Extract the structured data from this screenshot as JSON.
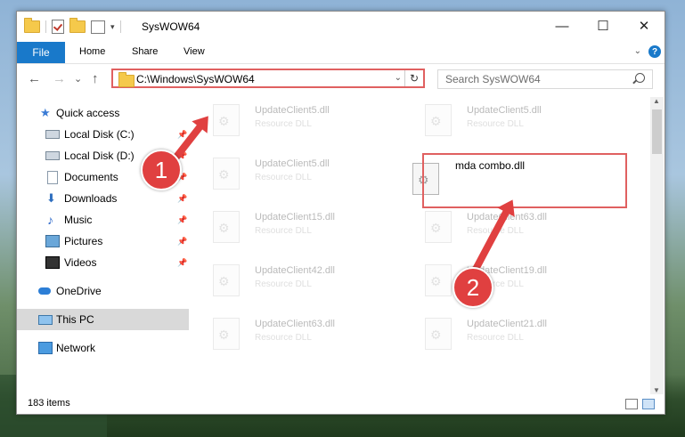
{
  "window": {
    "title": "SysWOW64",
    "minimize": "—",
    "maximize": "☐",
    "close": "✕"
  },
  "menu": {
    "file": "File",
    "home": "Home",
    "share": "Share",
    "view": "View",
    "help": "?"
  },
  "nav": {
    "back": "←",
    "forward": "→",
    "recent": "⌄",
    "up": "↑",
    "address": "C:\\Windows\\SysWOW64",
    "search_placeholder": "Search SysWOW64"
  },
  "sidebar": {
    "items": [
      {
        "label": "Quick access",
        "icon": "star-icon",
        "pinned": false
      },
      {
        "label": "Local Disk (C:)",
        "icon": "drive-icon",
        "pinned": true
      },
      {
        "label": "Local Disk (D:)",
        "icon": "drive-icon",
        "pinned": true
      },
      {
        "label": "Documents",
        "icon": "documents-icon",
        "pinned": true
      },
      {
        "label": "Downloads",
        "icon": "downloads-icon",
        "pinned": true
      },
      {
        "label": "Music",
        "icon": "music-icon",
        "pinned": true
      },
      {
        "label": "Pictures",
        "icon": "pictures-icon",
        "pinned": true
      },
      {
        "label": "Videos",
        "icon": "videos-icon",
        "pinned": true
      },
      {
        "label": "OneDrive",
        "icon": "onedrive-icon",
        "pinned": false
      },
      {
        "label": "This PC",
        "icon": "this-pc-icon",
        "pinned": false,
        "selected": true
      },
      {
        "label": "Network",
        "icon": "network-icon",
        "pinned": false
      }
    ]
  },
  "files": [
    {
      "name": "UpdateClient5.dll",
      "type": "Resource DLL",
      "faded": true
    },
    {
      "name": "UpdateClient5.dll",
      "type": "Resource DLL",
      "faded": true
    },
    {
      "name": "UpdateClient5.dll",
      "type": "Resource DLL",
      "faded": true
    },
    {
      "name": "mda combo.dll",
      "type": "",
      "faded": false
    },
    {
      "name": "UpdateClient15.dll",
      "type": "Resource DLL",
      "faded": true
    },
    {
      "name": "UpdateClient63.dll",
      "type": "Resource DLL",
      "faded": true
    },
    {
      "name": "UpdateClient42.dll",
      "type": "Resource DLL",
      "faded": true
    },
    {
      "name": "UpdateClient19.dll",
      "type": "Resource DLL",
      "faded": true
    },
    {
      "name": "UpdateClient63.dll",
      "type": "Resource DLL",
      "faded": true
    },
    {
      "name": "UpdateClient21.dll",
      "type": "Resource DLL",
      "faded": true
    }
  ],
  "status": {
    "item_count": "183 items"
  },
  "annotations": {
    "step1": "1",
    "step2": "2"
  },
  "colors": {
    "accent": "#1979ca",
    "callout": "#e04040",
    "highlight_border": "#e06060"
  }
}
